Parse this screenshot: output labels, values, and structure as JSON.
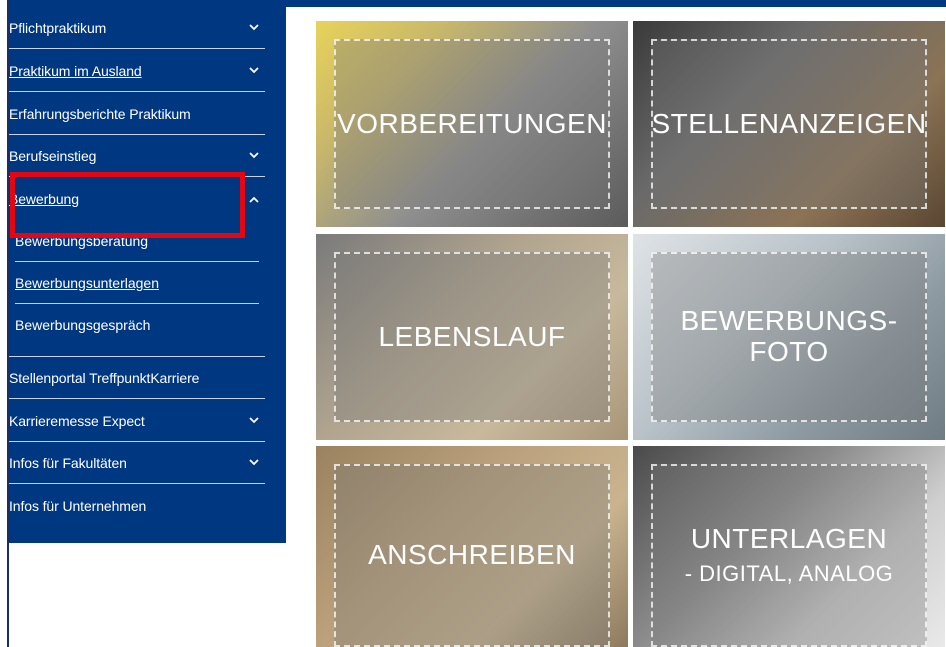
{
  "nav": {
    "items": [
      {
        "label": "Pflichtpraktikum",
        "chevron": "down",
        "underline": false
      },
      {
        "label": "Praktikum im Ausland",
        "chevron": "down",
        "underline": true
      },
      {
        "label": "Erfahrungsberichte Praktikum",
        "chevron": "",
        "underline": false
      },
      {
        "label": "Berufseinstieg",
        "chevron": "down",
        "underline": false
      },
      {
        "label": "Bewerbung",
        "chevron": "up",
        "underline": true
      }
    ],
    "subitems": [
      {
        "label": "Bewerbungsberatung",
        "underline": false
      },
      {
        "label": "Bewerbungsunterlagen",
        "underline": true
      },
      {
        "label": "Bewerbungsgespräch",
        "underline": false
      }
    ],
    "items_after": [
      {
        "label": "Stellenportal TreffpunktKarriere",
        "chevron": "",
        "underline": false
      },
      {
        "label": "Karrieremesse Expect",
        "chevron": "down",
        "underline": false
      },
      {
        "label": "Infos für Fakultäten",
        "chevron": "down",
        "underline": false
      },
      {
        "label": "Infos für Unternehmen",
        "chevron": "",
        "underline": false
      }
    ]
  },
  "tiles": [
    {
      "title": "VORBEREITUNGEN",
      "subtitle": ""
    },
    {
      "title": "STELLENANZEIGEN",
      "subtitle": ""
    },
    {
      "title": "LEBENSLAUF",
      "subtitle": ""
    },
    {
      "title": "BEWERBUNGS-",
      "subtitle": "FOTO"
    },
    {
      "title": "ANSCHREIBEN",
      "subtitle": ""
    },
    {
      "title": "UNTERLAGEN",
      "subtitle": "- DIGITAL, ANALOG"
    }
  ],
  "colors": {
    "sidebar": "#003781",
    "highlight": "#e30613"
  }
}
